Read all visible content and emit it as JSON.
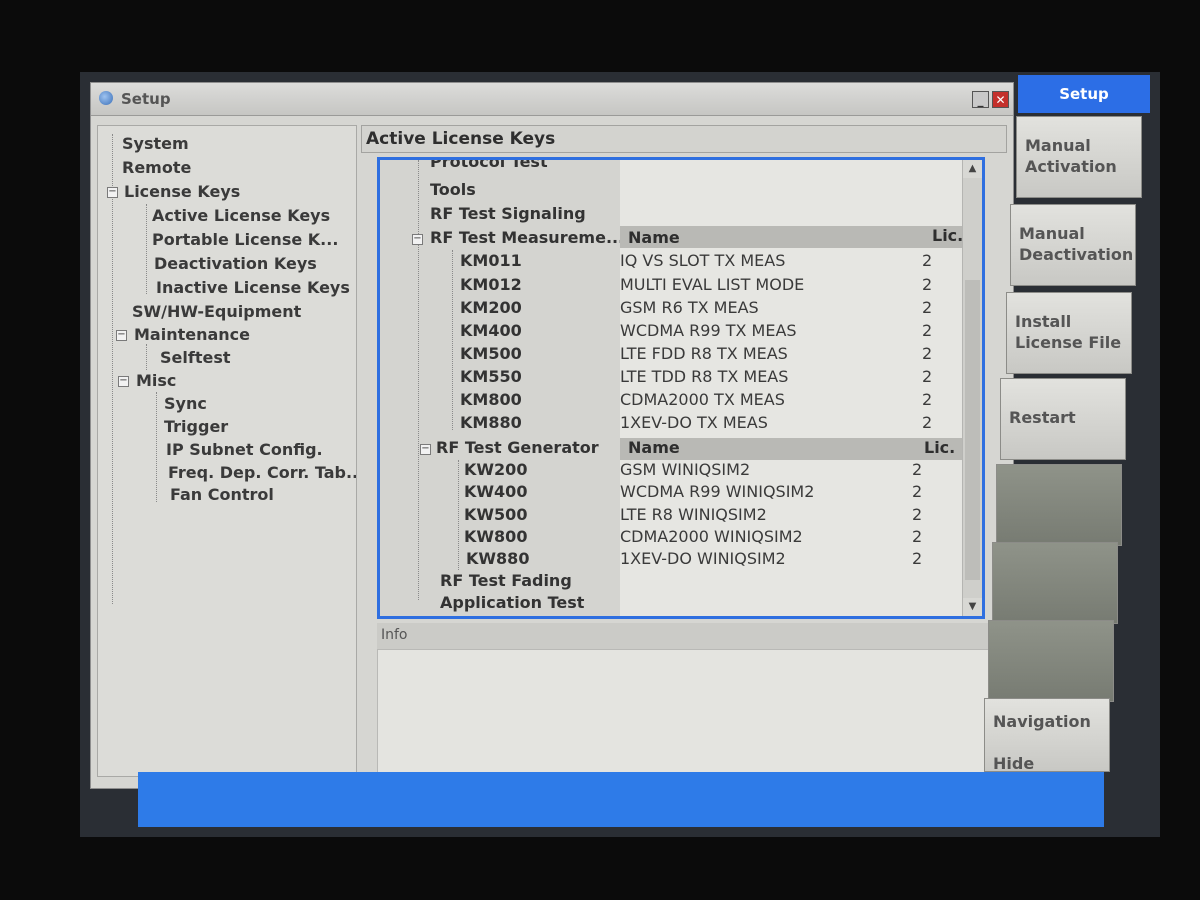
{
  "window": {
    "title": "Setup",
    "minimize_glyph": "_",
    "close_glyph": "✕"
  },
  "nav_tree": {
    "items": [
      {
        "label": "System"
      },
      {
        "label": "Remote"
      },
      {
        "label": "License Keys"
      },
      {
        "label": "Active License Keys"
      },
      {
        "label": "Portable License K..."
      },
      {
        "label": "Deactivation Keys"
      },
      {
        "label": "Inactive License Keys"
      },
      {
        "label": "SW/HW-Equipment"
      },
      {
        "label": "Maintenance"
      },
      {
        "label": "Selftest"
      },
      {
        "label": "Misc"
      },
      {
        "label": "Sync"
      },
      {
        "label": "Trigger"
      },
      {
        "label": "IP Subnet Config."
      },
      {
        "label": "Freq. Dep. Corr. Tab..."
      },
      {
        "label": "Fan Control"
      }
    ]
  },
  "content": {
    "title": "Active License Keys",
    "tree": {
      "protocol_test": "Protocol Test",
      "tools": "Tools",
      "rf_test_signaling": "RF Test Signaling",
      "rf_test_measurement": "RF Test Measureme...",
      "rf_test_generator": "RF Test Generator",
      "rf_test_fading": "RF Test Fading",
      "application_test": "Application Test"
    },
    "columns": {
      "name": "Name",
      "lic": "Lic."
    },
    "measurement_keys": [
      {
        "key": "KM011",
        "name": "IQ VS SLOT TX MEAS",
        "lic": "2"
      },
      {
        "key": "KM012",
        "name": "MULTI EVAL LIST MODE",
        "lic": "2"
      },
      {
        "key": "KM200",
        "name": "GSM R6 TX MEAS",
        "lic": "2"
      },
      {
        "key": "KM400",
        "name": "WCDMA R99 TX MEAS",
        "lic": "2"
      },
      {
        "key": "KM500",
        "name": "LTE FDD R8 TX MEAS",
        "lic": "2"
      },
      {
        "key": "KM550",
        "name": "LTE TDD R8 TX MEAS",
        "lic": "2"
      },
      {
        "key": "KM800",
        "name": "CDMA2000 TX MEAS",
        "lic": "2"
      },
      {
        "key": "KM880",
        "name": "1XEV-DO TX MEAS",
        "lic": "2"
      }
    ],
    "generator_keys": [
      {
        "key": "KW200",
        "name": "GSM WINIQSIM2",
        "lic": "2"
      },
      {
        "key": "KW400",
        "name": "WCDMA R99 WINIQSIM2",
        "lic": "2"
      },
      {
        "key": "KW500",
        "name": "LTE R8 WINIQSIM2",
        "lic": "2"
      },
      {
        "key": "KW800",
        "name": "CDMA2000 WINIQSIM2",
        "lic": "2"
      },
      {
        "key": "KW880",
        "name": "1XEV-DO WINIQSIM2",
        "lic": "2"
      }
    ],
    "scroll_up": "▲",
    "scroll_down": "▼"
  },
  "info": {
    "label": "Info"
  },
  "softkeys": {
    "setup_tab": "Setup",
    "manual_activation": "Manual\nActivation",
    "manual_deactivation": "Manual\nDeactivation",
    "install_license_file": "Install\nLicense File",
    "restart": "Restart",
    "navigation_hide": "Navigation\n\nHide"
  },
  "colors": {
    "accent": "#2c6ee6",
    "status_bar": "#2e7be8",
    "close_button": "#c4302b"
  }
}
